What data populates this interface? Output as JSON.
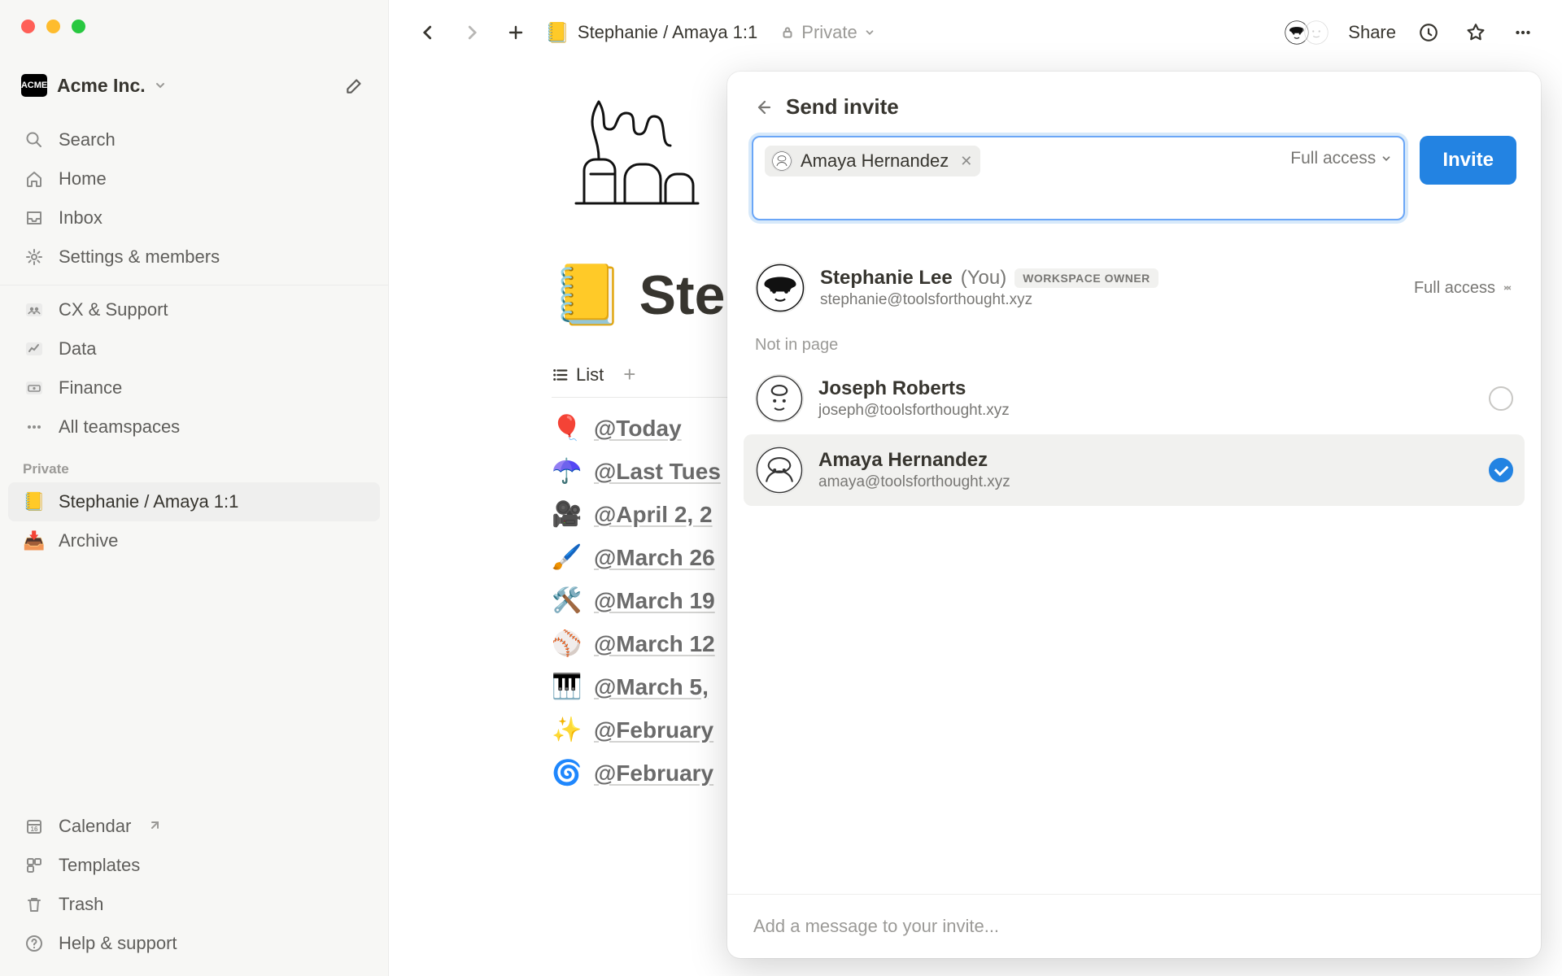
{
  "workspace": {
    "name": "Acme Inc.",
    "logo_text": "ACME"
  },
  "sidebar": {
    "search": "Search",
    "home": "Home",
    "inbox": "Inbox",
    "settings": "Settings & members",
    "teams": [
      {
        "emoji_svg": "people",
        "label": "CX & Support"
      },
      {
        "emoji_svg": "chart",
        "label": "Data"
      },
      {
        "emoji_svg": "money",
        "label": "Finance"
      }
    ],
    "all_teamspaces": "All teamspaces",
    "private_label": "Private",
    "private": [
      {
        "emoji": "📒",
        "label": "Stephanie / Amaya 1:1",
        "active": true
      },
      {
        "emoji": "📥",
        "label": "Archive"
      }
    ],
    "calendar": "Calendar",
    "templates": "Templates",
    "trash": "Trash",
    "help": "Help & support"
  },
  "topbar": {
    "breadcrumb_emoji": "📒",
    "breadcrumb": "Stephanie / Amaya 1:1",
    "visibility": "Private",
    "share": "Share"
  },
  "page": {
    "title_emoji": "📒",
    "title": "Step",
    "tabs": {
      "list": "List"
    },
    "items": [
      {
        "emoji": "🎈",
        "title": "@Today"
      },
      {
        "emoji": "☂️",
        "title": "@Last Tues"
      },
      {
        "emoji": "🎥",
        "title": "@April 2, 2"
      },
      {
        "emoji": "🖌️",
        "title": "@March 26"
      },
      {
        "emoji": "🛠️",
        "title": "@March 19"
      },
      {
        "emoji": "⚾",
        "title": "@March 12"
      },
      {
        "emoji": "🎹",
        "title": "@March 5,"
      },
      {
        "emoji": "✨",
        "title": "@February"
      },
      {
        "emoji": "🌀",
        "title": "@February"
      }
    ]
  },
  "popover": {
    "title": "Send invite",
    "chip": {
      "name": "Amaya Hernandez"
    },
    "permission": "Full access",
    "invite_btn": "Invite",
    "owner": {
      "name": "Stephanie Lee",
      "you": "(You)",
      "badge": "WORKSPACE OWNER",
      "email": "stephanie@toolsforthought.xyz",
      "permission": "Full access"
    },
    "not_in_label": "Not in page",
    "people": [
      {
        "name": "Joseph Roberts",
        "email": "joseph@toolsforthought.xyz",
        "selected": false
      },
      {
        "name": "Amaya Hernandez",
        "email": "amaya@toolsforthought.xyz",
        "selected": true
      }
    ],
    "message_placeholder": "Add a message to your invite..."
  }
}
